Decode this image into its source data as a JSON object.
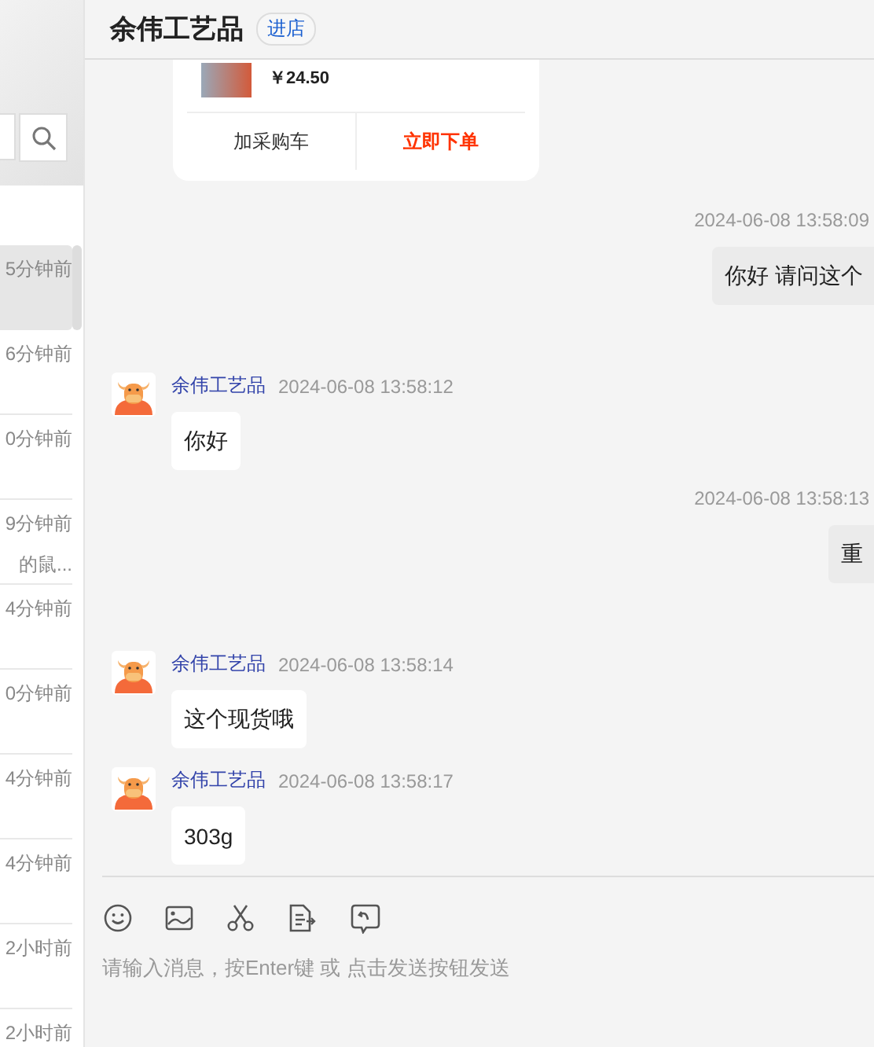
{
  "sidebar": {
    "items": [
      {
        "time": "5分钟前",
        "selected": true
      },
      {
        "time": "6分钟前",
        "selected": false
      },
      {
        "time": "0分钟前",
        "selected": false
      },
      {
        "time": "9分钟前",
        "preview": "的鼠...",
        "selected": false
      },
      {
        "time": "4分钟前",
        "selected": false
      },
      {
        "time": "0分钟前",
        "selected": false
      },
      {
        "time": "4分钟前",
        "selected": false
      },
      {
        "time": "4分钟前",
        "selected": false
      },
      {
        "time": "2小时前",
        "selected": false
      },
      {
        "time": "2小时前",
        "selected": false
      }
    ]
  },
  "chat": {
    "title": "余伟工艺品",
    "shop_badge": "进店",
    "product_card": {
      "price": "￥24.50",
      "add_button": "加采购车",
      "order_button": "立即下单"
    },
    "messages": [
      {
        "kind": "outgoing",
        "time": "2024-06-08 13:58:09",
        "text": "你好 请问这个"
      },
      {
        "kind": "incoming",
        "sender": "余伟工艺品",
        "time": "2024-06-08 13:58:12",
        "text": "你好"
      },
      {
        "kind": "outgoing",
        "time": "2024-06-08 13:58:13",
        "text": "重"
      },
      {
        "kind": "incoming",
        "sender": "余伟工艺品",
        "time": "2024-06-08 13:58:14",
        "text": "这个现货哦"
      },
      {
        "kind": "incoming",
        "sender": "余伟工艺品",
        "time": "2024-06-08 13:58:17",
        "text": "303g"
      }
    ],
    "input": {
      "placeholder": "请输入消息，按Enter键 或 点击发送按钮发送"
    }
  }
}
